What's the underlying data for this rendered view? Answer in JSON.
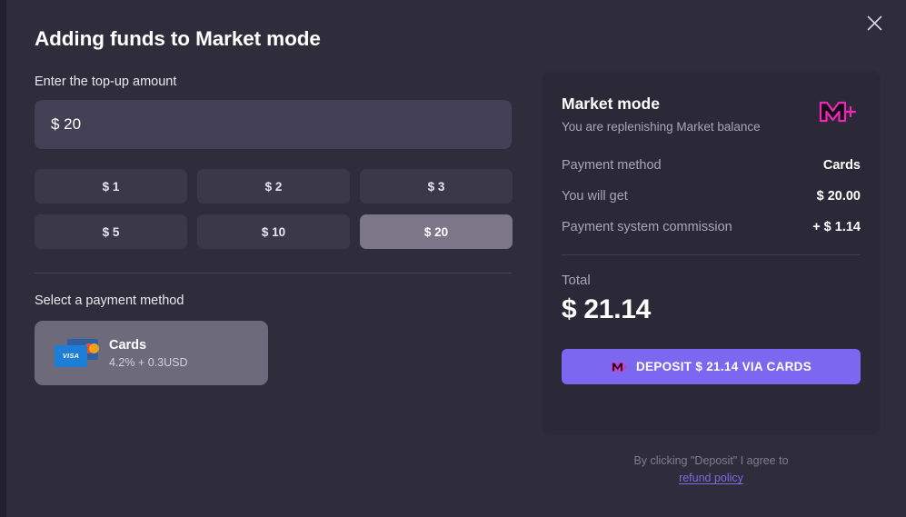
{
  "modal": {
    "title": "Adding funds to Market mode",
    "close_icon": "close-icon"
  },
  "amount_section": {
    "label": "Enter the top-up amount",
    "input_value": "$ 20",
    "input_placeholder": "$ 0",
    "presets": [
      {
        "label": "$ 1",
        "selected": false
      },
      {
        "label": "$ 2",
        "selected": false
      },
      {
        "label": "$ 3",
        "selected": false
      },
      {
        "label": "$ 5",
        "selected": false
      },
      {
        "label": "$ 10",
        "selected": false
      },
      {
        "label": "$ 20",
        "selected": true
      }
    ]
  },
  "payment_section": {
    "label": "Select a payment method",
    "methods": [
      {
        "name": "Cards",
        "fee": "4.2% + 0.3USD",
        "icon": "credit-cards-icon",
        "visa_label": "VISA",
        "selected": true
      }
    ]
  },
  "summary": {
    "title": "Market mode",
    "subtitle": "You are replenishing Market balance",
    "logo_icon": "market-m-logo",
    "rows": [
      {
        "key": "Payment method",
        "value": "Cards"
      },
      {
        "key": "You will get",
        "value": "$ 20.00"
      },
      {
        "key": "Payment system commission",
        "value": "+ $ 1.14"
      }
    ],
    "total_label": "Total",
    "total_amount": "$ 21.14",
    "deposit_button": "DEPOSIT $ 21.14 VIA CARDS"
  },
  "footer": {
    "text": "By clicking \"Deposit\" I agree to",
    "link": "refund policy"
  },
  "colors": {
    "modal_bg": "#2f2d3c",
    "panel_bg": "#2b2937",
    "input_bg": "#433f54",
    "preset_bg": "#3b384a",
    "preset_selected_bg": "#7b7789",
    "method_selected_bg": "#6d6a7c",
    "accent_purple": "#7c68f0",
    "link_purple": "#7b6de0",
    "brand_pink": "#ef27b4",
    "muted_text": "#a9a6b6"
  }
}
